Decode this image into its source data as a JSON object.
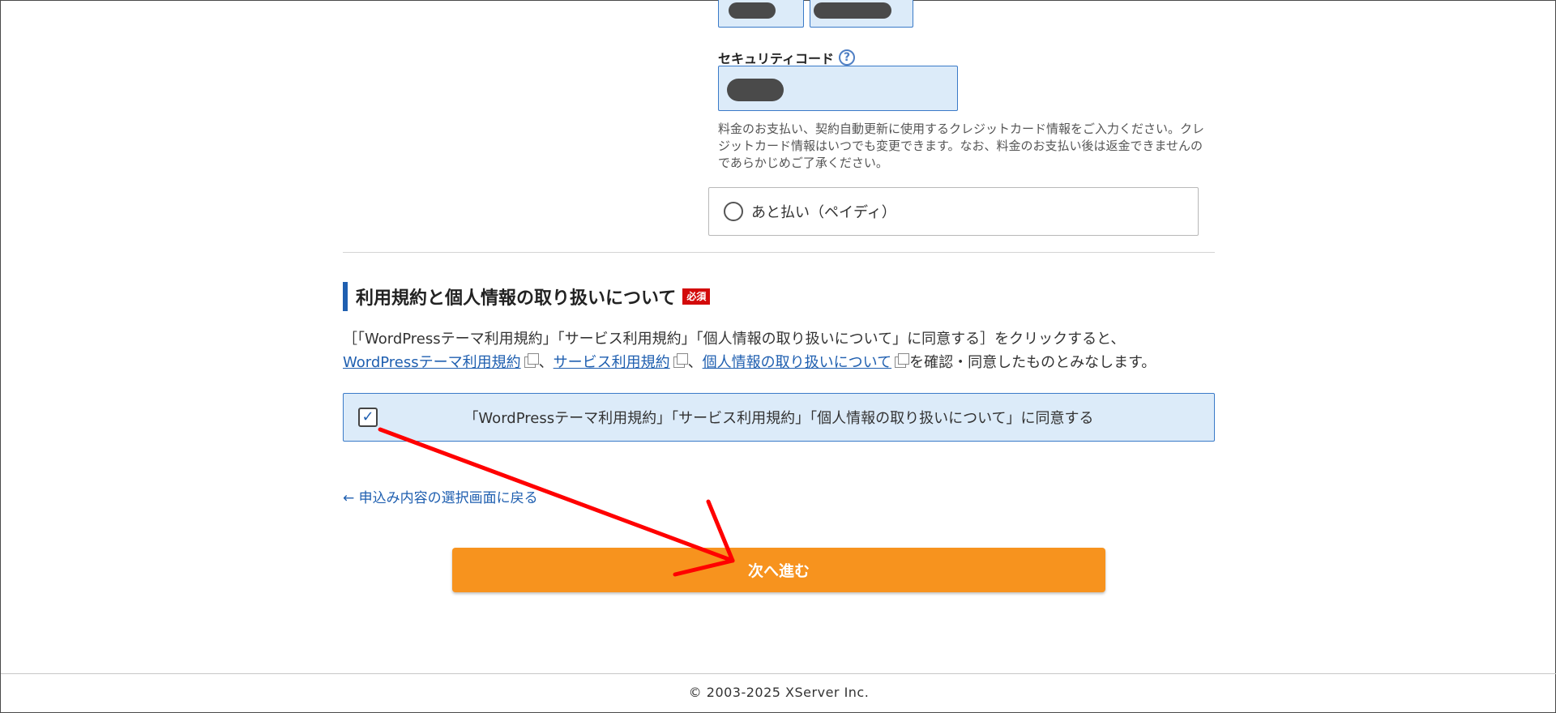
{
  "security_code": {
    "label": "セキュリティコード",
    "help_icon": "?"
  },
  "card_note": "料金のお支払い、契約自動更新に使用するクレジットカード情報をご入力ください。クレジットカード情報はいつでも変更できます。なお、料金のお支払い後は返金できませんのであらかじめご了承ください。",
  "payment_option": {
    "label": "あと払い（ペイディ）"
  },
  "terms_section": {
    "heading": "利用規約と個人情報の取り扱いについて",
    "required_badge": "必須",
    "desc_prefix": "［「WordPressテーマ利用規約」「サービス利用規約」「個人情報の取り扱いについて」に同意する］をクリックすると、",
    "link_wordpress": "WordPressテーマ利用規約",
    "separator": "、",
    "link_service": "サービス利用規約",
    "link_privacy": "個人情報の取り扱いについて",
    "desc_suffix": "を確認・同意したものとみなします。",
    "agree_label": "「WordPressテーマ利用規約」「サービス利用規約」「個人情報の取り扱いについて」に同意する",
    "agree_checked": true,
    "check_mark": "✓"
  },
  "back_link": "← 申込み内容の選択画面に戻る",
  "next_button": "次へ進む",
  "footer": "© 2003-2025 XServer Inc.",
  "colors": {
    "accent_orange": "#f7931e",
    "input_bg": "#dcebf9",
    "link_blue": "#1f5fb0",
    "required_red": "#d30a0a",
    "annotation_red": "#ff0000"
  }
}
